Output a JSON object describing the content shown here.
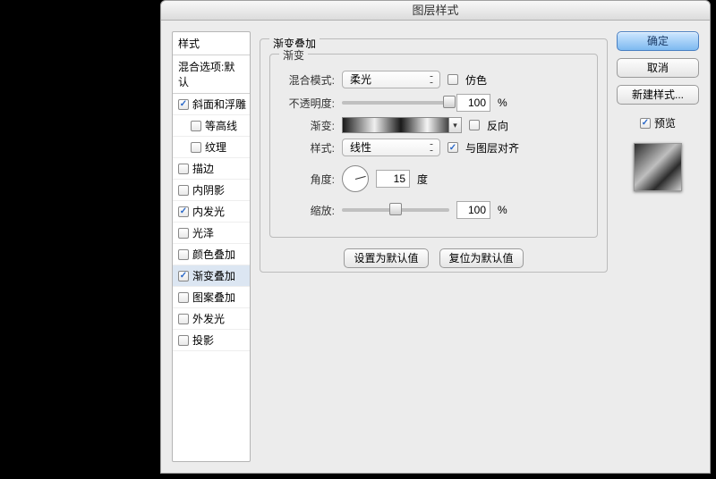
{
  "title": "图层样式",
  "sidebar": {
    "header": "样式",
    "blendopts": "混合选项:默认",
    "items": [
      {
        "label": "斜面和浮雕",
        "checked": true
      },
      {
        "label": "等高线",
        "checked": false,
        "sub": true
      },
      {
        "label": "纹理",
        "checked": false,
        "sub": true
      },
      {
        "label": "描边",
        "checked": false
      },
      {
        "label": "内阴影",
        "checked": false
      },
      {
        "label": "内发光",
        "checked": true
      },
      {
        "label": "光泽",
        "checked": false
      },
      {
        "label": "颜色叠加",
        "checked": false
      },
      {
        "label": "渐变叠加",
        "checked": true,
        "selected": true
      },
      {
        "label": "图案叠加",
        "checked": false
      },
      {
        "label": "外发光",
        "checked": false
      },
      {
        "label": "投影",
        "checked": false
      }
    ]
  },
  "panel": {
    "title_outer": "渐变叠加",
    "title": "渐变",
    "blend_label": "混合模式:",
    "blend_value": "柔光",
    "dither": "仿色",
    "opacity_label": "不透明度:",
    "opacity_value": "100",
    "pct": "%",
    "gradient_label": "渐变:",
    "reverse": "反向",
    "style_label": "样式:",
    "style_value": "线性",
    "align": "与图层对齐",
    "angle_label": "角度:",
    "angle_value": "15",
    "deg": "度",
    "scale_label": "缩放:",
    "scale_value": "100",
    "set_default": "设置为默认值",
    "reset_default": "复位为默认值"
  },
  "buttons": {
    "ok": "确定",
    "cancel": "取消",
    "newstyle": "新建样式...",
    "preview": "预览"
  }
}
